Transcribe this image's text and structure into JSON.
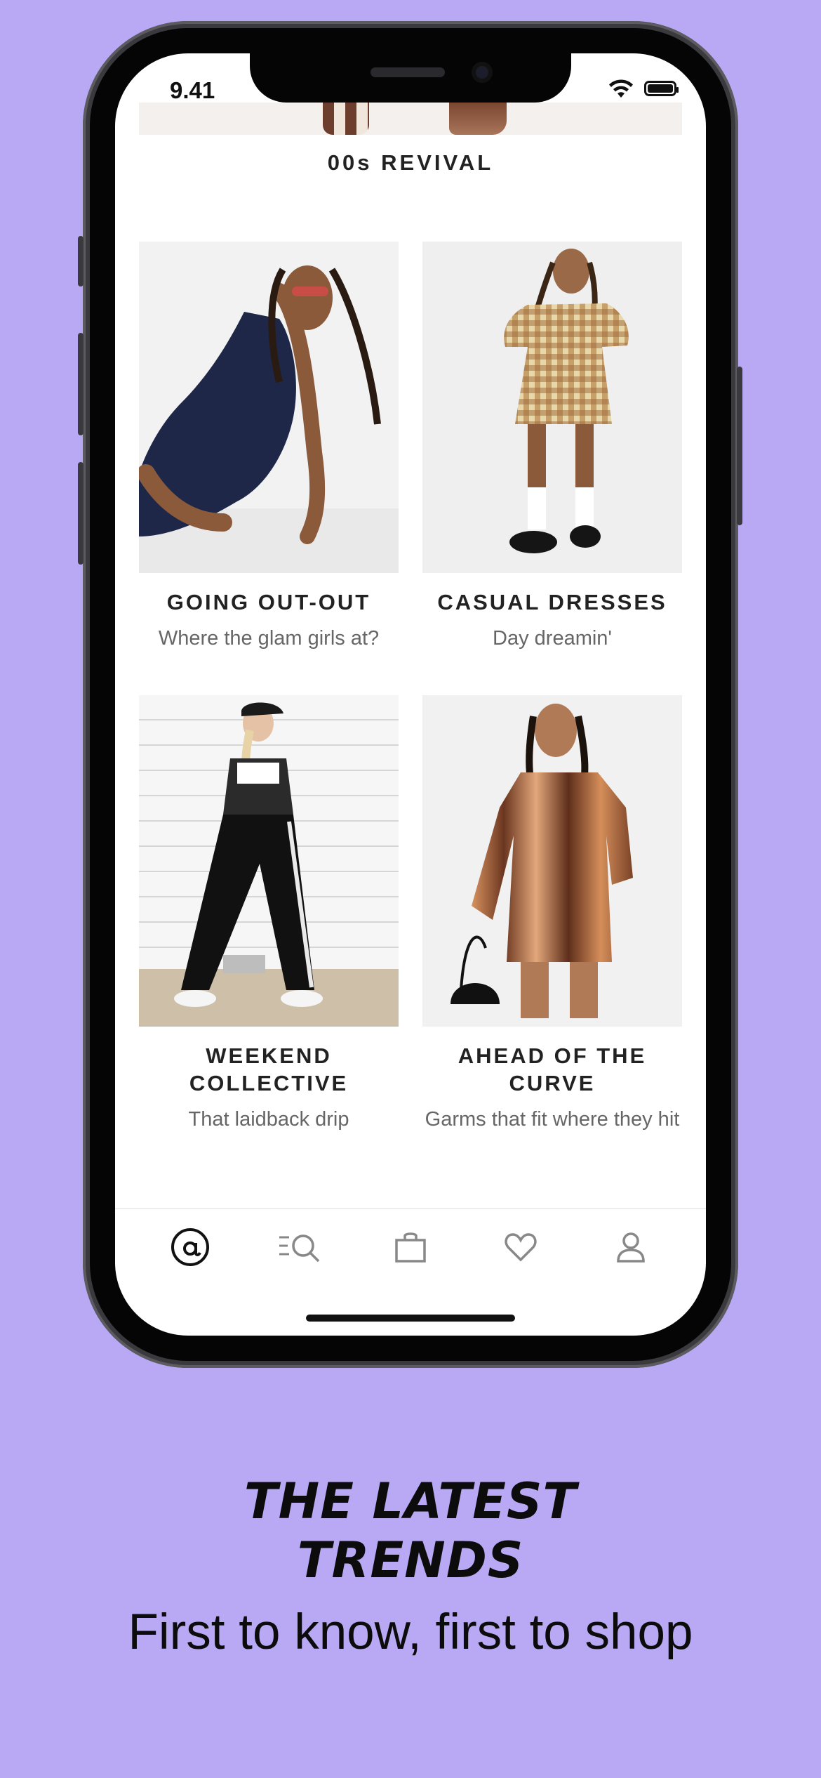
{
  "status_bar": {
    "time": "9.41"
  },
  "section": {
    "title": "00s REVIVAL"
  },
  "cards": [
    {
      "title": "GOING OUT-OUT",
      "subtitle": "Where the glam girls at?"
    },
    {
      "title": "CASUAL DRESSES",
      "subtitle": "Day dreamin'"
    },
    {
      "title": "WEEKEND COLLECTIVE",
      "subtitle": "That laidback drip"
    },
    {
      "title": "AHEAD OF THE CURVE",
      "subtitle": "Garms that fit where they hit"
    }
  ],
  "tab_bar": {
    "items": [
      {
        "icon": "asos-home-icon",
        "active": true
      },
      {
        "icon": "search-list-icon",
        "active": false
      },
      {
        "icon": "bag-icon",
        "active": false
      },
      {
        "icon": "heart-icon",
        "active": false
      },
      {
        "icon": "account-icon",
        "active": false
      }
    ]
  },
  "promo": {
    "headline_line1": "THE LATEST",
    "headline_line2": "TRENDS",
    "subheadline": "First to know, first to shop"
  },
  "colors": {
    "background": "#B9A8F3",
    "text_primary": "#222222",
    "text_secondary": "#666666"
  }
}
